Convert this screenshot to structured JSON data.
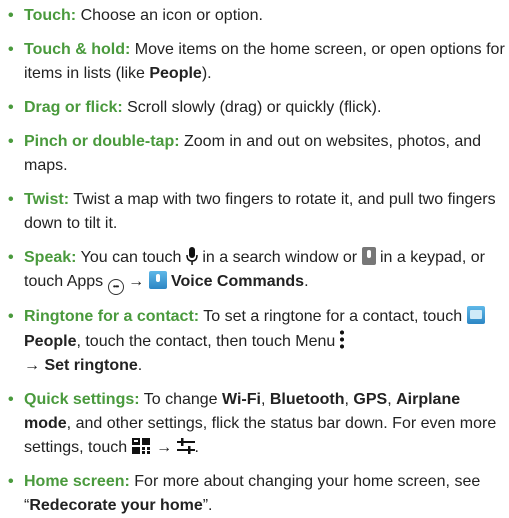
{
  "bullet": "•",
  "arrow": "→",
  "items": [
    {
      "term": "Touch:",
      "text": " Choose an icon or option."
    },
    {
      "term": "Touch & hold:",
      "text_a": " Move items on the home screen, or open options for items in lists (like ",
      "bold_a": "People",
      "text_b": ")."
    },
    {
      "term": "Drag or flick:",
      "text": " Scroll slowly (drag) or quickly (flick)."
    },
    {
      "term": "Pinch or double-tap:",
      "text": " Zoom in and out on websites, photos, and maps."
    },
    {
      "term": "Twist:",
      "text": " Twist a map with two fingers to rotate it, and pull two fingers down to tilt it."
    },
    {
      "term": "Speak:",
      "text_a": " You can touch ",
      "text_b": " in a search window or ",
      "text_c": " in a keypad, or touch Apps ",
      "bold_a": "Voice Commands",
      "text_d": "."
    },
    {
      "term": "Ringtone for a contact:",
      "text_a": " To set a ringtone for a contact, touch ",
      "bold_a": "People",
      "text_b": ", touch the contact, then touch Menu ",
      "bold_b": "Set ringtone",
      "text_c": "."
    },
    {
      "term": "Quick settings:",
      "text_a": " To change ",
      "bold_a": "Wi-Fi",
      "text_b": ", ",
      "bold_b": "Bluetooth",
      "text_c": ", ",
      "bold_c": "GPS",
      "text_d": ", ",
      "bold_d": "Airplane mode",
      "text_e": ", and other settings, flick the status bar down. For even more settings, touch ",
      "text_f": "."
    },
    {
      "term": "Home screen:",
      "text_a": " For more about changing your home screen, see “",
      "bold_a": "Redecorate your home",
      "text_b": "”."
    }
  ],
  "icons": {
    "mic": "microphone-icon",
    "keypad_mic": "keypad-microphone-icon",
    "apps": "apps-icon",
    "voice": "voice-commands-icon",
    "people": "people-icon",
    "menu": "menu-icon",
    "quick_settings": "quick-settings-icon",
    "settings": "settings-sliders-icon"
  },
  "colors": {
    "term": "#4a9a3d",
    "text": "#222222"
  }
}
